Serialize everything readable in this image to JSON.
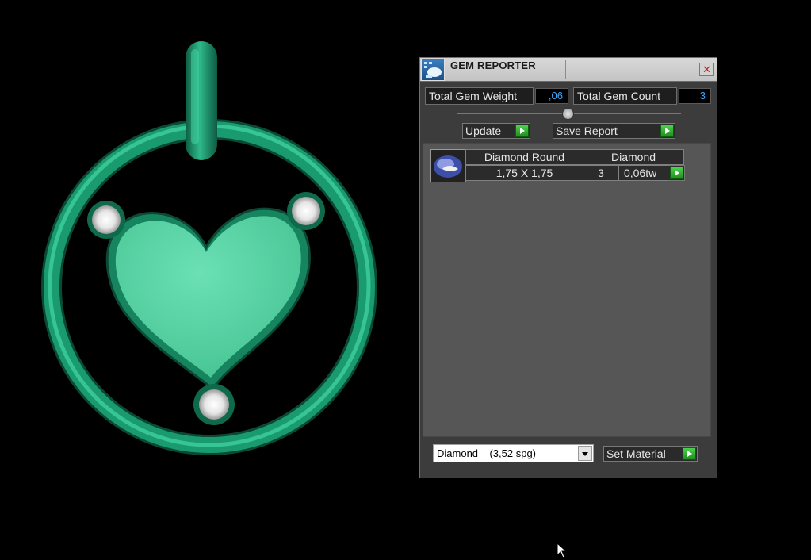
{
  "panel": {
    "title": "GEM REPORTER",
    "close_glyph": "✕",
    "total_weight_label": "Total Gem Weight",
    "total_weight_value": ",06",
    "total_count_label": "Total Gem Count",
    "total_count_value": "3",
    "update_label": "Update",
    "save_report_label": "Save Report",
    "icons": [
      "gem-reporter-app-icon",
      "close-icon",
      "play-icon",
      "gem-thumbnail-icon",
      "dropdown-arrow-icon"
    ]
  },
  "gem_list": {
    "rows": [
      {
        "shape": "Diamond Round",
        "material": "Diamond",
        "size": "1,75 X 1,75",
        "count": "3",
        "weight": "0,06tw"
      }
    ]
  },
  "material_selector": {
    "value": "Diamond    (3,52 spg)",
    "set_label": "Set Material"
  },
  "viewport": {
    "model": "heart pendant",
    "metal_color": "#1f9e76",
    "heart_color": "#5ed4a8"
  }
}
